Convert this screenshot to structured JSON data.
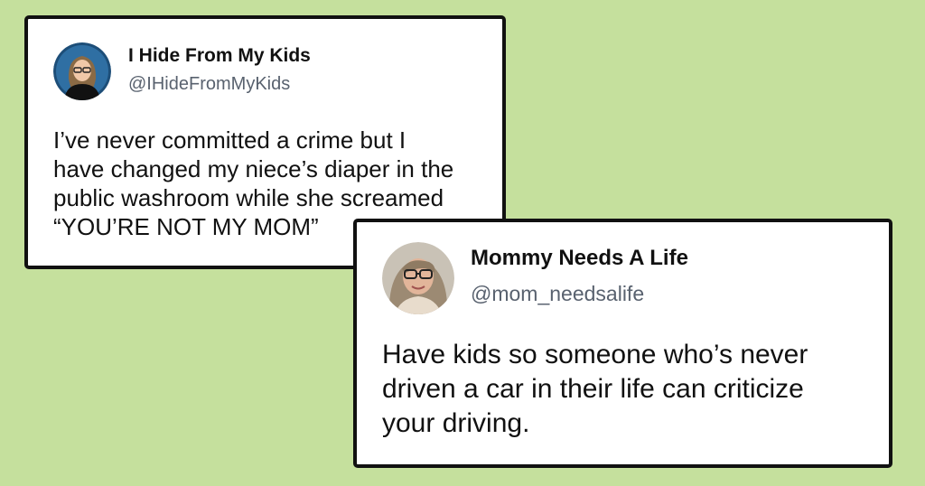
{
  "background_color": "#c5e09d",
  "tweets": [
    {
      "display_name": "I Hide From My Kids",
      "handle": "@IHideFromMyKids",
      "text": "I’ve never committed a crime but I\nhave changed my niece’s diaper in the\npublic washroom while she screamed\n“YOU’RE NOT MY MOM”",
      "avatar": "avatar-photo"
    },
    {
      "display_name": "Mommy Needs A Life",
      "handle": "@mom_needsalife",
      "text": "Have kids so someone who’s never\ndriven a car in their life can criticize\nyour driving.",
      "avatar": "avatar-photo"
    }
  ]
}
